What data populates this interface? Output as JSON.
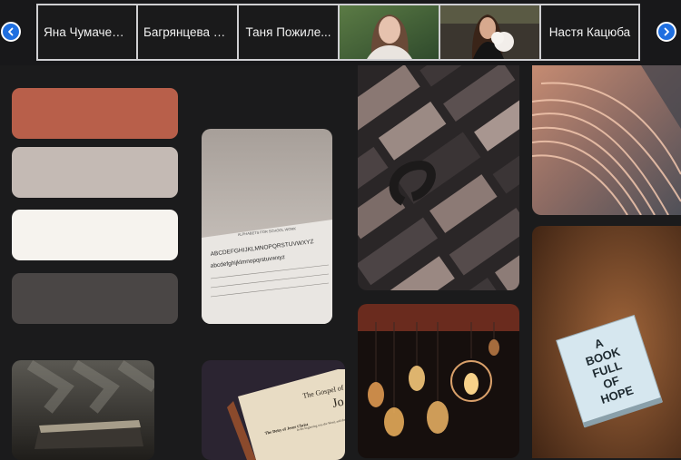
{
  "strip": {
    "items": [
      {
        "type": "text",
        "label": "Яна Чумаченко"
      },
      {
        "type": "text",
        "label": "Багрянцева Е..."
      },
      {
        "type": "text",
        "label": "Таня Пожиле..."
      },
      {
        "type": "photo",
        "icon": "person-photo"
      },
      {
        "type": "photo",
        "icon": "person-with-cotton-candy-photo"
      },
      {
        "type": "text",
        "label": "Настя Кацюба"
      }
    ],
    "prev_icon": "chevron-left-icon",
    "next_icon": "chevron-right-icon"
  },
  "palette": {
    "colors": [
      "#b85f4a",
      "#c4bab4",
      "#f6f3ee",
      "#4a4645"
    ]
  },
  "gallery": {
    "paper_alphabet_chart_text": "ALPHABETS FOR SCHOOL WORK",
    "paper_alphabet_lines": [
      "ABCDEFGHIJKLMNOPQRSTUVWXYZ",
      "abcdefghijklmnopqrstuvwxyz"
    ],
    "gospel_title": "The Gospel of",
    "gospel_name": "Jo",
    "gospel_subhead": "The Deity of Jesus Christ",
    "gospel_body": "In the beginning was the Word, and the Word was with God, and the Word was God.",
    "book_cover_text": [
      "A",
      "BOOK",
      "FULL",
      "OF",
      "HOPE"
    ]
  }
}
